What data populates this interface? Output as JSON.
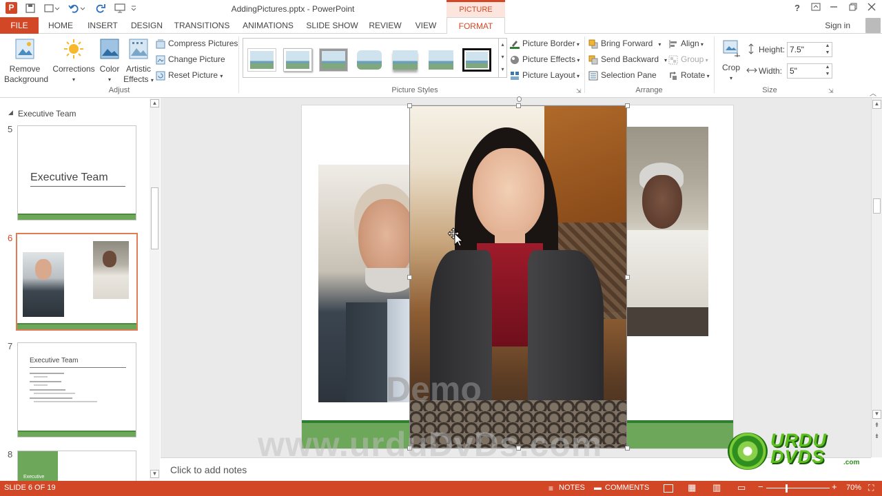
{
  "window": {
    "title": "AddingPictures.pptx - PowerPoint",
    "context_tab_header": "PICTURE TOOLS",
    "help": "?",
    "signin": "Sign in"
  },
  "tabs": [
    "FILE",
    "HOME",
    "INSERT",
    "DESIGN",
    "TRANSITIONS",
    "ANIMATIONS",
    "SLIDE SHOW",
    "REVIEW",
    "VIEW",
    "FORMAT"
  ],
  "ribbon": {
    "adjust": {
      "remove_background": "Remove Background",
      "remove_line1": "Remove",
      "remove_line2": "Background",
      "corrections": "Corrections",
      "color": "Color",
      "artistic_line1": "Artistic",
      "artistic_line2": "Effects",
      "compress": "Compress Pictures",
      "change": "Change Picture",
      "reset": "Reset Picture",
      "group_label": "Adjust"
    },
    "picture_styles": {
      "border": "Picture Border",
      "effects": "Picture Effects",
      "layout": "Picture Layout",
      "group_label": "Picture Styles"
    },
    "arrange": {
      "bring_forward": "Bring Forward",
      "send_backward": "Send Backward",
      "selection_pane": "Selection Pane",
      "align": "Align",
      "group": "Group",
      "rotate": "Rotate",
      "group_label": "Arrange"
    },
    "size": {
      "crop": "Crop",
      "height_label": "Height:",
      "height_value": "7.5\"",
      "width_label": "Width:",
      "width_value": "5\"",
      "group_label": "Size"
    }
  },
  "thumbnails": {
    "section": "Executive Team",
    "slides": [
      {
        "num": "5",
        "title": "Executive Team"
      },
      {
        "num": "6",
        "title": ""
      },
      {
        "num": "7",
        "title": "Executive Team"
      },
      {
        "num": "8",
        "title": "Executive"
      }
    ]
  },
  "notes_placeholder": "Click to add notes",
  "status": {
    "slide": "SLIDE 6 OF 19",
    "notes": "NOTES",
    "comments": "COMMENTS",
    "zoom": "70%"
  },
  "watermarks": {
    "demo": "Demo",
    "url": "www.urduDvDs.com",
    "logo_line1": "URDU",
    "logo_line2": "DVDS",
    "logo_line3": ".com"
  },
  "colors": {
    "accent": "#d24726",
    "slide_green": "#6da759"
  }
}
